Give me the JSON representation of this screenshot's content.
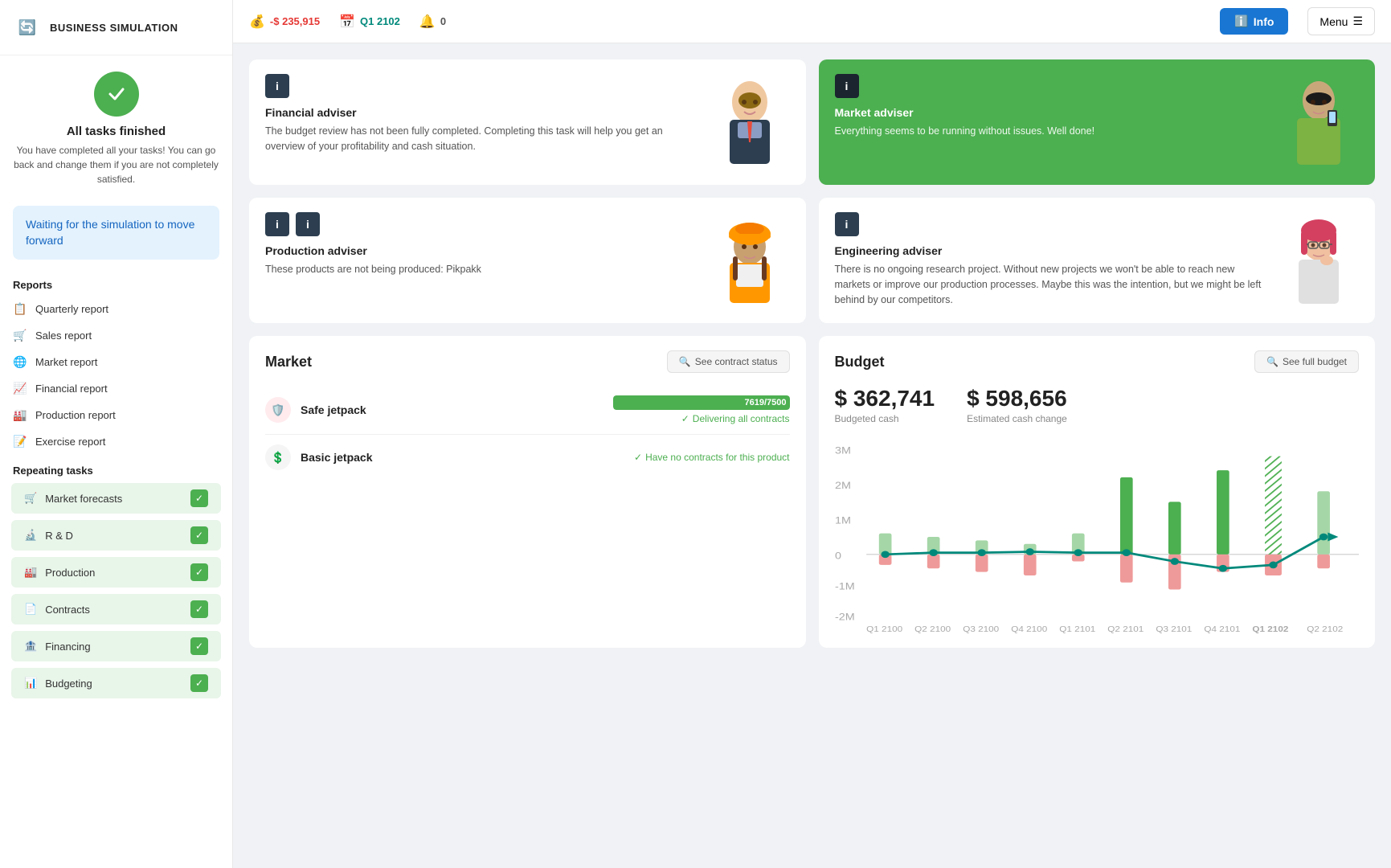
{
  "app": {
    "title": "BUSINESS SIMULATION",
    "logo": "🔄"
  },
  "topbar": {
    "balance": "-$ 235,915",
    "quarter": "Q1 2102",
    "notifications": "0",
    "info_label": "Info",
    "menu_label": "Menu"
  },
  "sidebar": {
    "status": {
      "title": "All tasks finished",
      "description": "You have completed all your tasks! You can go back and change them if you are not completely satisfied."
    },
    "waiting": "Waiting for the simulation to move forward",
    "reports_label": "Reports",
    "reports": [
      {
        "icon": "📋",
        "label": "Quarterly report"
      },
      {
        "icon": "🛒",
        "label": "Sales report"
      },
      {
        "icon": "🌐",
        "label": "Market report"
      },
      {
        "icon": "📈",
        "label": "Financial report"
      },
      {
        "icon": "🏭",
        "label": "Production report"
      },
      {
        "icon": "📝",
        "label": "Exercise report"
      }
    ],
    "repeating_label": "Repeating tasks",
    "repeating": [
      {
        "icon": "🛒",
        "label": "Market forecasts",
        "done": true
      },
      {
        "icon": "🔬",
        "label": "R & D",
        "done": true
      },
      {
        "icon": "🏭",
        "label": "Production",
        "done": true
      },
      {
        "icon": "📄",
        "label": "Contracts",
        "done": true
      },
      {
        "icon": "🏦",
        "label": "Financing",
        "done": true
      },
      {
        "icon": "📊",
        "label": "Budgeting",
        "done": true
      }
    ]
  },
  "advisers": {
    "financial": {
      "name": "Financial adviser",
      "text": "The budget review has not been fully completed. Completing this task will help you get an overview of your profitability and cash situation.",
      "variant": "white"
    },
    "market": {
      "name": "Market adviser",
      "text": "Everything seems to be running without issues. Well done!",
      "variant": "green"
    },
    "production": {
      "name": "Production adviser",
      "text": "These products are not being produced: Pikpakk",
      "variant": "white"
    },
    "engineering": {
      "name": "Engineering adviser",
      "text": "There is no ongoing research project. Without new projects we won't be able to reach new markets or improve our production processes. Maybe this was the intention, but we might be left behind by our competitors.",
      "variant": "white"
    }
  },
  "market": {
    "title": "Market",
    "see_contract_btn": "See contract status",
    "products": [
      {
        "name": "Safe jetpack",
        "icon": "🛡️",
        "icon_type": "red",
        "progress_value": 7619,
        "progress_max": 7500,
        "progress_pct": 100,
        "progress_label": "7619/7500",
        "status": "Delivering all contracts",
        "status_type": "right"
      },
      {
        "name": "Basic jetpack",
        "icon": "💲",
        "icon_type": "gray",
        "status": "Have no contracts for this product",
        "status_type": "right",
        "no_progress": true
      }
    ]
  },
  "budget": {
    "title": "Budget",
    "see_full_btn": "See full budget",
    "budgeted_cash": "$ 362,741",
    "budgeted_cash_label": "Budgeted cash",
    "estimated_change": "$ 598,656",
    "estimated_change_label": "Estimated cash change",
    "chart": {
      "y_labels": [
        "3M",
        "2M",
        "1M",
        "0",
        "-1M",
        "-2M"
      ],
      "x_labels": [
        "Q1 2100",
        "Q2 2100",
        "Q3 2100",
        "Q4 2100",
        "Q1 2101",
        "Q2 2101",
        "Q3 2101",
        "Q4 2101",
        "Q1 2102",
        "Q2 2102"
      ],
      "bars_green": [
        0.6,
        0.5,
        0.4,
        0.3,
        0.6,
        2.2,
        1.5,
        2.4,
        2.8,
        1.9
      ],
      "bars_red": [
        0.3,
        0.4,
        0.5,
        0.6,
        0.2,
        0.8,
        1.0,
        0.5,
        0.6,
        0.4
      ],
      "line": [
        0,
        0.05,
        0.05,
        0.08,
        0.05,
        0.05,
        -0.2,
        -0.4,
        -0.3,
        0.5
      ]
    }
  }
}
